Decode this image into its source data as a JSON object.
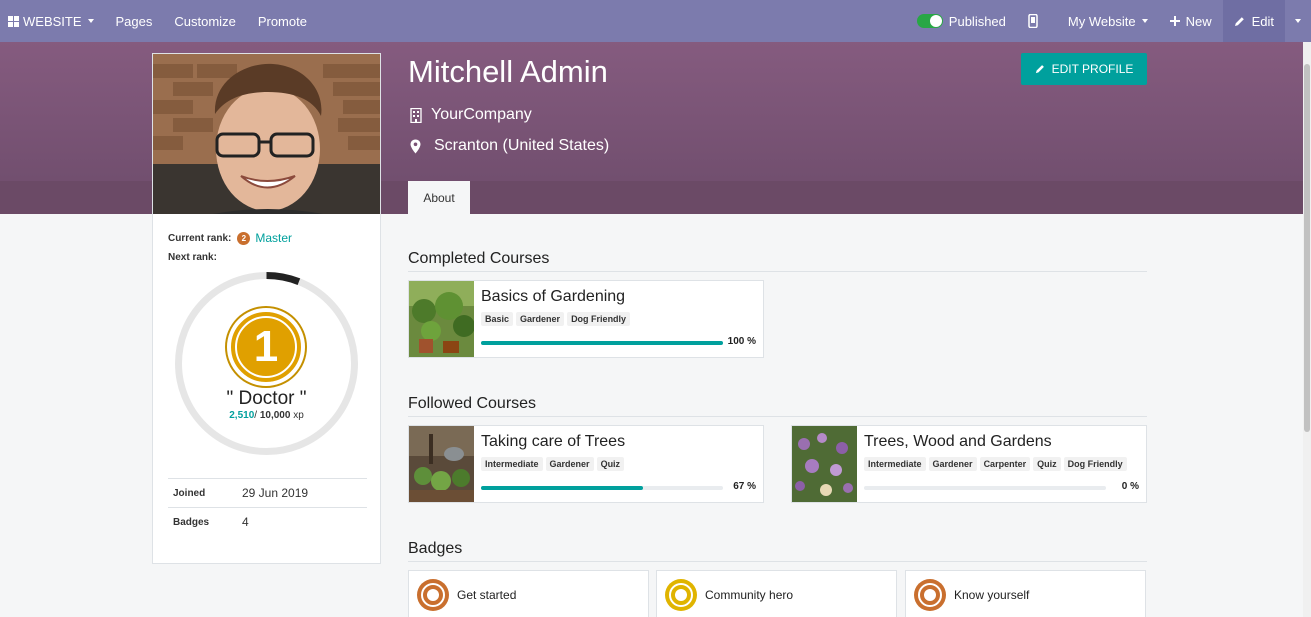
{
  "navbar": {
    "brand": "WEBSITE",
    "items": [
      "Pages",
      "Customize",
      "Promote"
    ],
    "published_label": "Published",
    "my_website": "My Website",
    "new_label": "New",
    "edit_label": "Edit",
    "published_state": true
  },
  "profile": {
    "name": "Mitchell Admin",
    "company": "YourCompany",
    "location": "Scranton (United States)",
    "edit_button": "EDIT PROFILE",
    "tab_label": "About",
    "current_rank_label": "Current rank:",
    "current_rank_badge": "2",
    "current_rank_value": "Master",
    "next_rank_label": "Next rank:",
    "next_rank_number": "1",
    "next_rank_name": "\" Doctor \"",
    "xp_current": "2,510",
    "xp_separator": "/",
    "xp_total": "10,000",
    "xp_unit": "xp",
    "xp_progress": 0.06,
    "joined_label": "Joined",
    "joined_value": "29 Jun 2019",
    "badges_label": "Badges",
    "badges_value": "4"
  },
  "sections": {
    "completed": "Completed Courses",
    "followed": "Followed Courses",
    "badges": "Badges"
  },
  "completed_courses": [
    {
      "title": "Basics of Gardening",
      "tags": [
        "Basic",
        "Gardener",
        "Dog Friendly"
      ],
      "progress": 100,
      "progress_label": "100 %"
    }
  ],
  "followed_courses": [
    {
      "title": "Taking care of Trees",
      "tags": [
        "Intermediate",
        "Gardener",
        "Quiz"
      ],
      "progress": 67,
      "progress_label": "67 %"
    },
    {
      "title": "Trees, Wood and Gardens",
      "tags": [
        "Intermediate",
        "Gardener",
        "Carpenter",
        "Quiz",
        "Dog Friendly"
      ],
      "progress": 0,
      "progress_label": "0 %"
    }
  ],
  "badges": [
    {
      "name": "Get started",
      "color": "#c96f2e"
    },
    {
      "name": "Community hero",
      "color": "#e0b400"
    },
    {
      "name": "Know yourself",
      "color": "#c96f2e"
    }
  ],
  "colors": {
    "navbar": "#7c7bad",
    "banner": "#855b7f",
    "accent": "#00a09d",
    "rank_gold": "#e0a000"
  }
}
